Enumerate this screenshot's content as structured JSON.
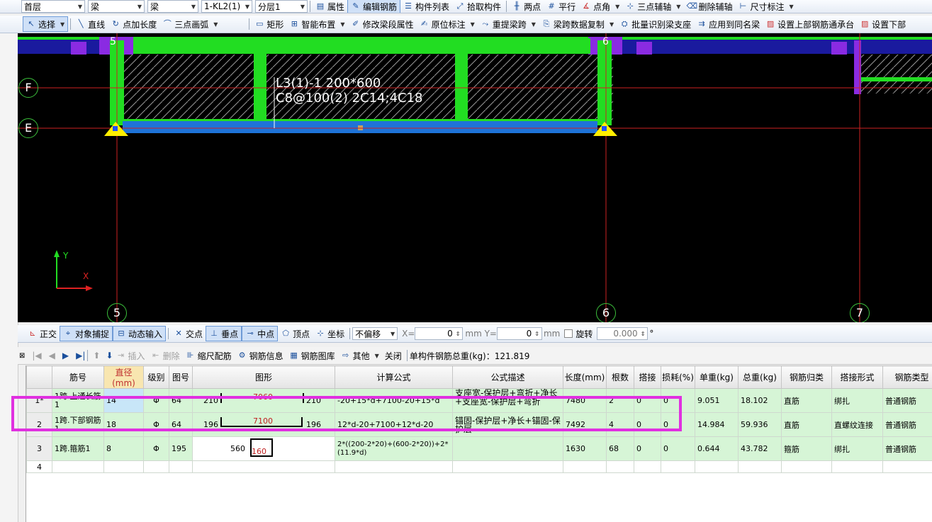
{
  "toolbar1": {
    "floor": "首层",
    "type1": "梁",
    "type2": "梁",
    "member": "1-KL2(1)",
    "layer": "分层1",
    "buttons": [
      "属性",
      "编辑钢筋",
      "构件列表",
      "拾取构件",
      "两点",
      "平行",
      "点角",
      "三点辅轴",
      "删除辅轴",
      "尺寸标注"
    ]
  },
  "toolbar2": {
    "buttons": [
      "选择",
      "直线",
      "点加长度",
      "三点画弧",
      "矩形",
      "智能布置",
      "修改梁段属性",
      "原位标注",
      "重提梁跨",
      "梁跨数据复制",
      "批量识别梁支座",
      "应用到同名梁",
      "设置上部钢筋通承台",
      "设置下部"
    ]
  },
  "canvas": {
    "grid_labels_top": [
      "5",
      "6"
    ],
    "grid_labels_bottom": [
      "5",
      "6",
      "7"
    ],
    "grid_labels_side": [
      "F",
      "E"
    ],
    "annotation_line1": "L3(1)-1 200*600",
    "annotation_line2": "C8@100(2) 2C14;4C18",
    "axis_y": "Y",
    "axis_x": "X"
  },
  "snapbar": {
    "buttons": [
      "正交",
      "对象捕捉",
      "动态输入",
      "交点",
      "垂点",
      "中点",
      "顶点",
      "坐标"
    ],
    "offset_mode": "不偏移",
    "x_label": "X=",
    "x_value": "0",
    "y_label": "mm Y=",
    "y_value": "0",
    "unit": "mm",
    "rotate_label": "旋转",
    "rotate_value": "0.000",
    "degree": "°"
  },
  "gridtoolbar": {
    "insert": "插入",
    "delete": "删除",
    "scale_rebar": "缩尺配筋",
    "rebar_info": "钢筋信息",
    "rebar_library": "钢筋图库",
    "other": "其他",
    "close": "关闭",
    "total_weight": "单构件钢筋总重(kg)：121.819"
  },
  "table": {
    "headers": [
      "筋号",
      "直径(mm)",
      "级别",
      "图号",
      "图形",
      "计算公式",
      "公式描述",
      "长度(mm)",
      "根数",
      "搭接",
      "损耗(%)",
      "单重(kg)",
      "总重(kg)",
      "钢筋归类",
      "搭接形式",
      "钢筋类型"
    ],
    "rows": [
      {
        "idx": "1*",
        "name": "1跨.上通长筋1",
        "dia": "14",
        "grade": "Φ",
        "fig": "64",
        "shape_left": "210",
        "shape_mid": "7060",
        "shape_right": "210",
        "formula": "-20+15*d+7100-20+15*d",
        "desc": "支座宽-保护层+弯折+净长+支座宽-保护层+弯折",
        "len": "7480",
        "count": "2",
        "lap": "0",
        "loss": "0",
        "unit_w": "9.051",
        "total_w": "18.102",
        "cat": "直筋",
        "lap_type": "绑扎",
        "rtype": "普通钢筋"
      },
      {
        "idx": "2",
        "name": "1跨.下部钢筋1",
        "dia": "18",
        "grade": "Φ",
        "fig": "64",
        "shape_left": "196",
        "shape_mid": "7100",
        "shape_right": "196",
        "formula": "12*d-20+7100+12*d-20",
        "desc": "锚固-保护层+净长+锚固-保护层",
        "len": "7492",
        "count": "4",
        "lap": "0",
        "loss": "0",
        "unit_w": "14.984",
        "total_w": "59.936",
        "cat": "直筋",
        "lap_type": "直螺纹连接",
        "rtype": "普通钢筋"
      },
      {
        "idx": "3",
        "name": "1跨.箍筋1",
        "dia": "8",
        "grade": "Φ",
        "fig": "195",
        "shape_left": "560",
        "shape_mid": "160",
        "shape_right": "",
        "formula": "2*((200-2*20)+(600-2*20))+2*(11.9*d)",
        "desc": "",
        "len": "1630",
        "count": "68",
        "lap": "0",
        "loss": "0",
        "unit_w": "0.644",
        "total_w": "43.782",
        "cat": "箍筋",
        "lap_type": "绑扎",
        "rtype": "普通钢筋"
      }
    ],
    "empty_row_idx": "4"
  },
  "colors": {
    "highlight": "#e030e0",
    "beam_green": "#22dd22",
    "beam_blue": "#1e73d8",
    "support_yellow": "#ffee00",
    "grid_red": "#cc2222"
  }
}
